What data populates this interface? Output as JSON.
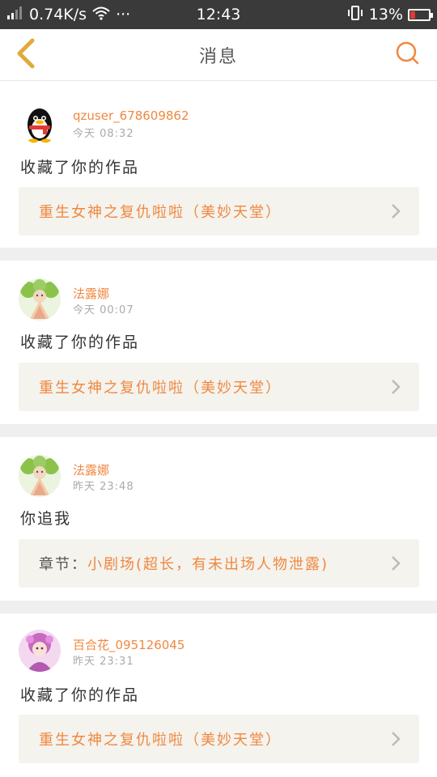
{
  "status_bar": {
    "signal": "⁰il",
    "speed": "0.74K/s",
    "more": "···",
    "time": "12:43",
    "battery": "13%"
  },
  "header": {
    "title": "消息"
  },
  "colors": {
    "accent": "#f0883f",
    "back_icon": "#e2a93b",
    "link_bg": "#f4f3ee",
    "divider": "#efefef"
  },
  "messages": [
    {
      "user": "qzuser_678609862",
      "time": "今天 08:32",
      "text": "收藏了你的作品",
      "link": "重生女神之复仇啦啦（美妙天堂）",
      "avatar": "qq-penguin-avatar"
    },
    {
      "user": "法露娜",
      "time": "今天 00:07",
      "text": "收藏了你的作品",
      "link": "重生女神之复仇啦啦（美妙天堂）",
      "avatar": "green-character-avatar"
    },
    {
      "user": "法露娜",
      "time": "昨天 23:48",
      "text": "你追我",
      "link_prefix": "章节：",
      "link": "小剧场(超长，有未出场人物泄露)",
      "avatar": "green-character-avatar"
    },
    {
      "user": "百合花_095126045",
      "time": "昨天 23:31",
      "text": "收藏了你的作品",
      "link": "重生女神之复仇啦啦（美妙天堂）",
      "avatar": "pink-character-avatar"
    }
  ]
}
